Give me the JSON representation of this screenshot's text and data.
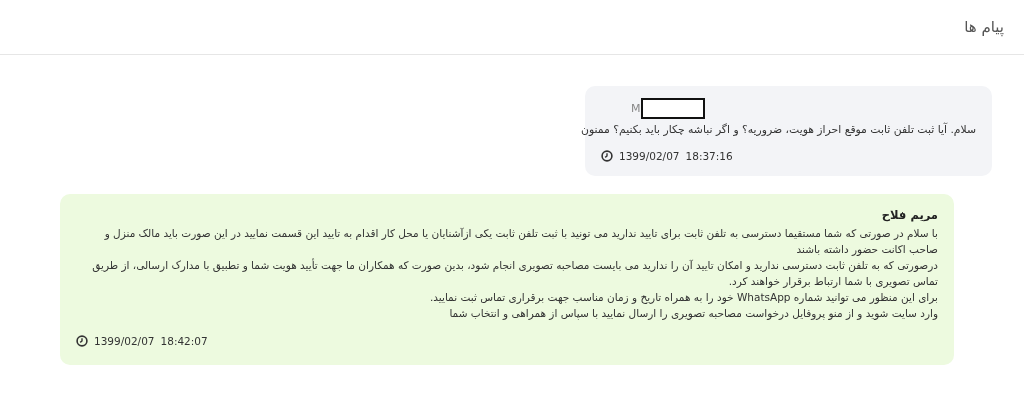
{
  "header": {
    "title": "پیام ها"
  },
  "messages": [
    {
      "kind": "sent",
      "sender": "M",
      "sender_redacted": true,
      "lines": [
        "سلام. آیا ثبت تلفن ثابت موقع احراز هویت، ضروریه؟ و اگر نباشه چکار باید بکنیم؟ ممنون"
      ],
      "date": "1399/02/07",
      "time": "18:37:16"
    },
    {
      "kind": "received",
      "sender": "مریم فلاح",
      "sender_redacted": false,
      "lines": [
        "با سلام در صورتی که شما مستقیما دسترسی به تلفن ثابت برای تایید ندارید می تونید با ثبت تلفن ثابت یکی ازآشنایان یا محل کار اقدام به تایید این قسمت نمایید در این صورت باید مالک منزل و",
        "صاحب اکانت حضور داشته باشند",
        "درصورتی که به تلفن ثابت دسترسی ندارید و امکان تایید آن را ندارید می بایست مصاحبه تصویری انجام شود، بدین صورت که همکاران ما جهت تأیید هویت شما و تطبیق با مدارک ارسالی، از طریق",
        "تماس تصویری با شما ارتباط برقرار خواهند کرد.",
        "برای این منظور می توانید شماره WhatsApp خود را به همراه تاریخ و زمان مناسب جهت برقراری تماس ثبت نمایید.",
        "وارد سایت شوید و از منو پروفایل درخواست مصاحبه تصویری را ارسال نمایید با سپاس از همراهی و انتخاب شما"
      ],
      "date": "1399/02/07",
      "time": "18:42:07"
    }
  ]
}
